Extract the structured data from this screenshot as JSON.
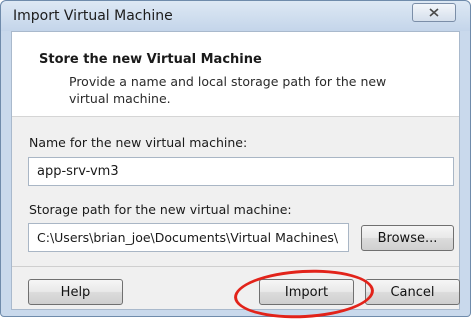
{
  "window": {
    "title": "Import Virtual Machine"
  },
  "header": {
    "title": "Store the new Virtual Machine",
    "description": "Provide a name and local storage path for the new virtual machine."
  },
  "form": {
    "name_label": "Name for the new virtual machine:",
    "name_value": "app-srv-vm3",
    "path_label": "Storage path for the new virtual machine:",
    "path_value": "C:\\Users\\brian_joe\\Documents\\Virtual Machines\\",
    "browse_label": "Browse..."
  },
  "footer": {
    "help_label": "Help",
    "import_label": "Import",
    "cancel_label": "Cancel"
  },
  "icons": {
    "close": "close-icon"
  },
  "colors": {
    "highlight": "#e2231a",
    "frame": "#c9d9ec"
  }
}
